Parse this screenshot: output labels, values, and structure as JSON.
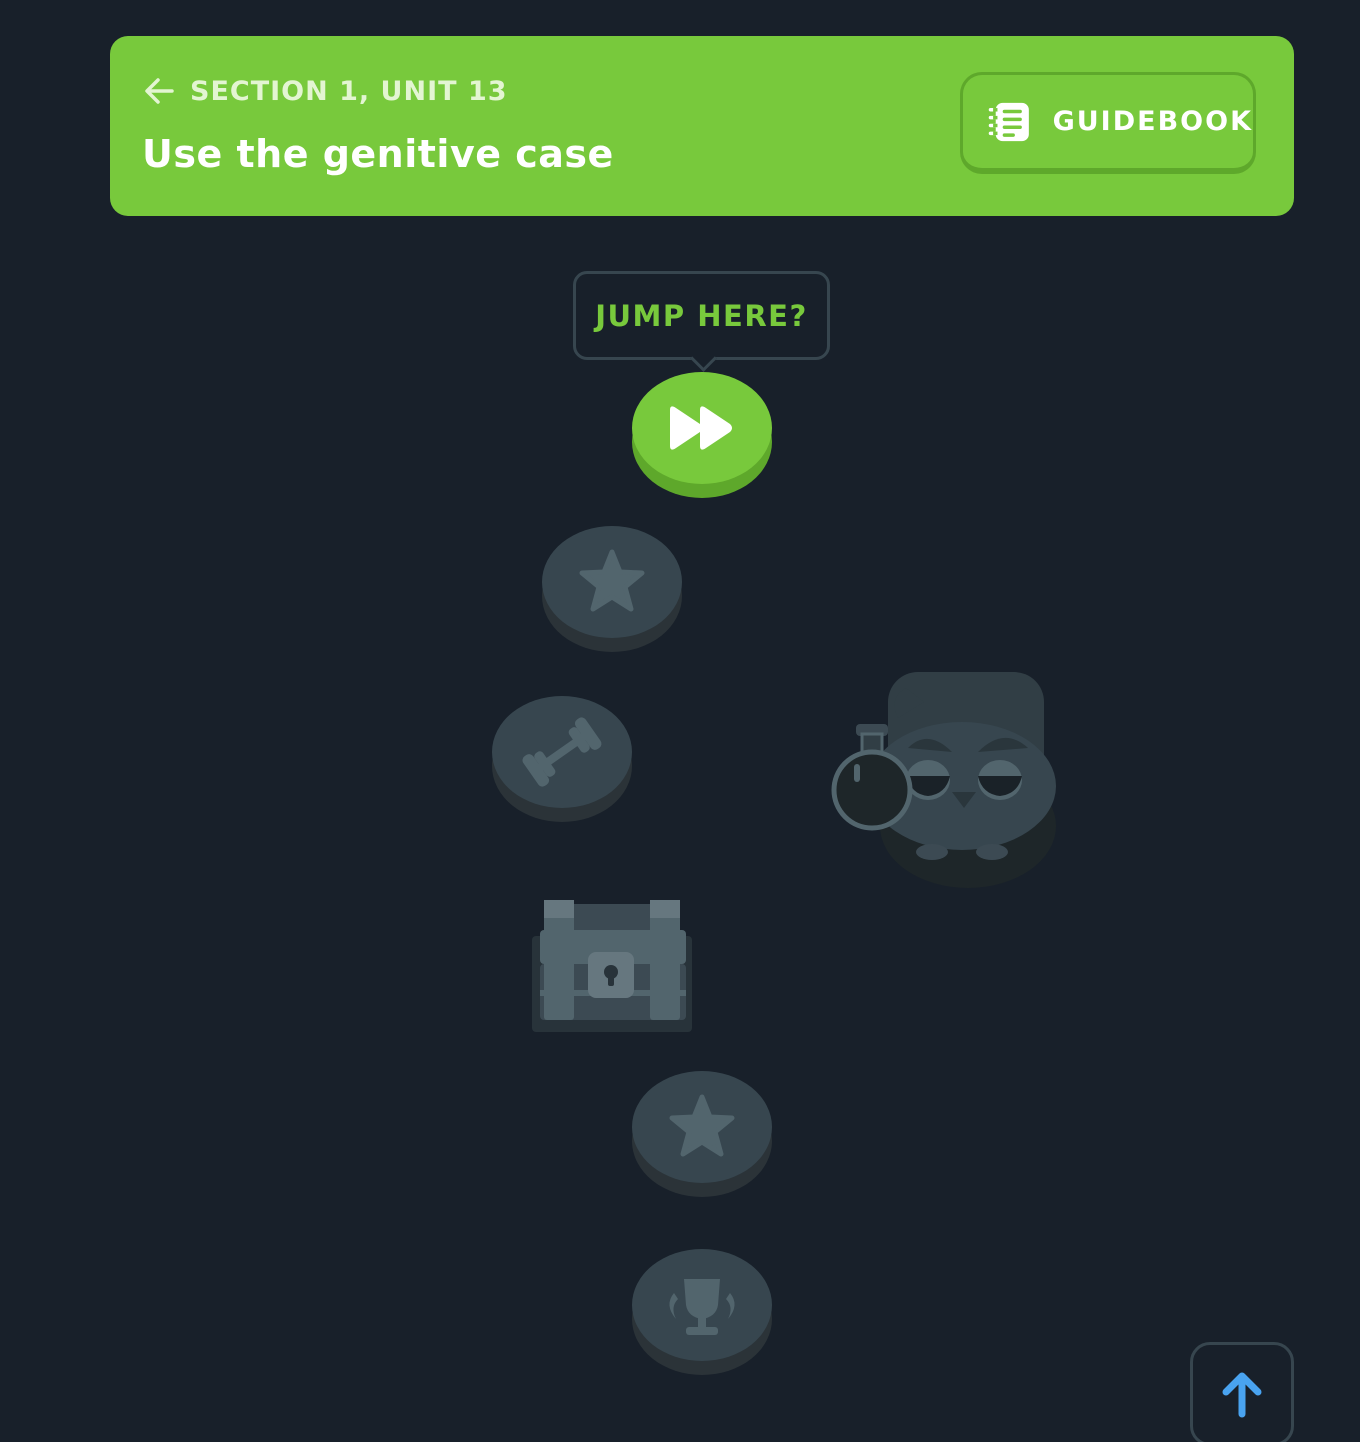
{
  "header": {
    "section_label": "SECTION 1, UNIT 13",
    "unit_title": "Use the genitive case",
    "guidebook_label": "GUIDEBOOK",
    "back_icon": "arrow-left-icon",
    "guidebook_icon": "notebook-icon"
  },
  "path": {
    "jump_tooltip": "JUMP HERE?",
    "nodes": [
      {
        "type": "jump",
        "icon": "fast-forward-icon",
        "state": "active"
      },
      {
        "type": "lesson",
        "icon": "star-icon",
        "state": "locked"
      },
      {
        "type": "practice",
        "icon": "dumbbell-icon",
        "state": "locked"
      },
      {
        "type": "chest",
        "icon": "treasure-chest-icon",
        "state": "locked"
      },
      {
        "type": "lesson",
        "icon": "star-icon",
        "state": "locked"
      },
      {
        "type": "unit-review",
        "icon": "trophy-icon",
        "state": "locked"
      }
    ],
    "character": "owl-with-potion-icon"
  },
  "scroll_top_icon": "arrow-up-icon",
  "colors": {
    "background": "#18202a",
    "brand_green": "#78c93c",
    "locked_node": "#37464f",
    "accent_blue": "#49a3f0"
  }
}
